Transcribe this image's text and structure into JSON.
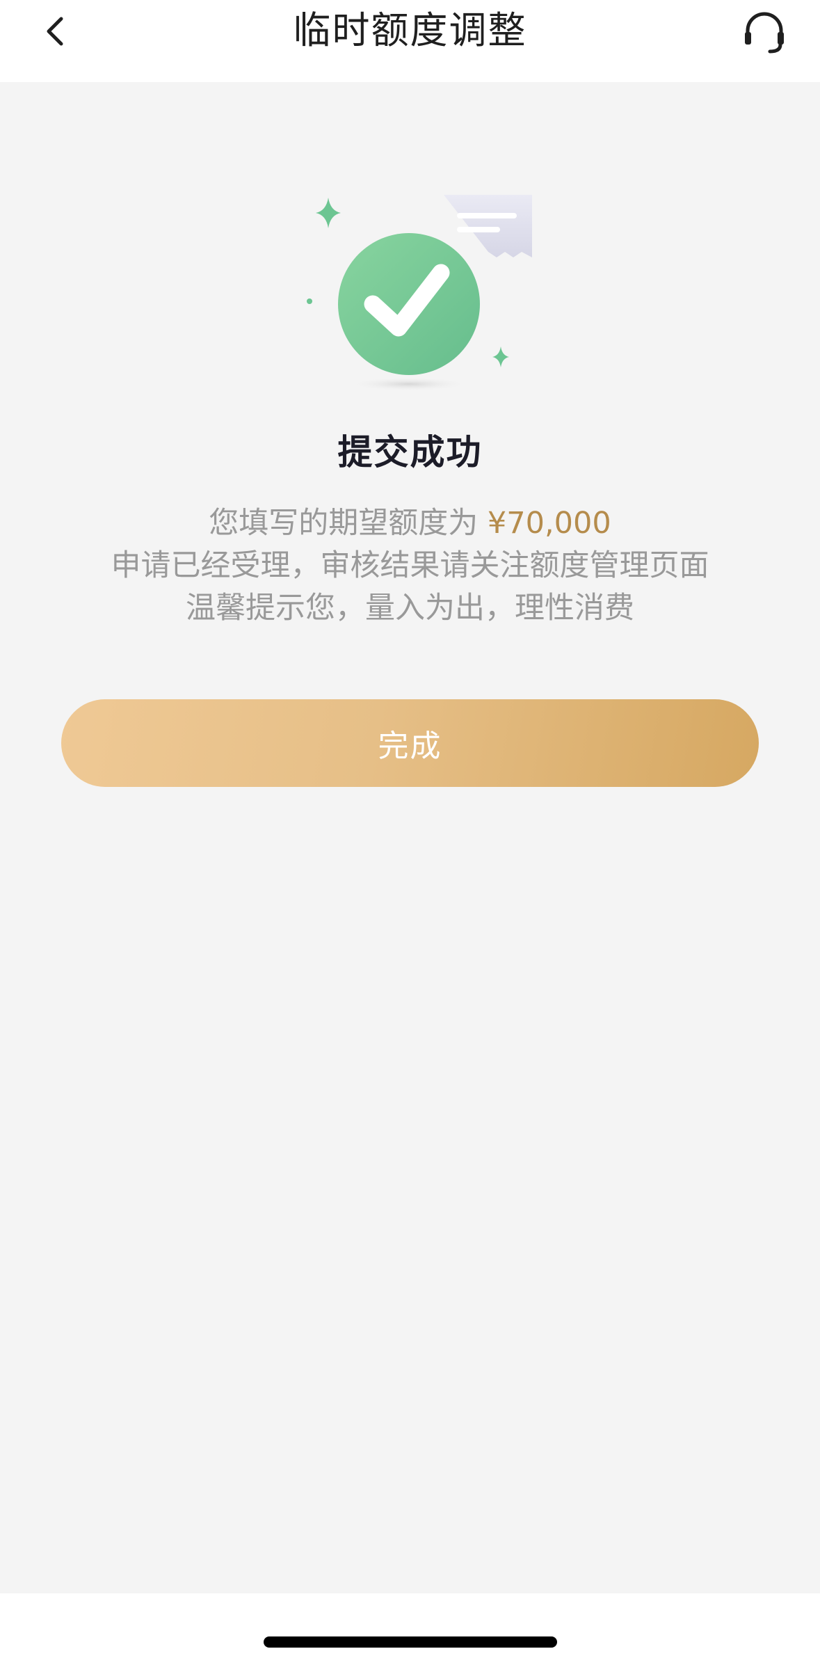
{
  "header": {
    "title": "临时额度调整",
    "back_icon": "chevron-left-icon",
    "support_icon": "headset-icon"
  },
  "result": {
    "icon": "success-check-icon",
    "title": "提交成功",
    "line1_prefix": "您填写的期望额度为 ",
    "amount": "¥70,000",
    "line2": "申请已经受理，审核结果请关注额度管理页面",
    "line3": "温馨提示您，量入为出，理性消费"
  },
  "actions": {
    "done_label": "完成"
  },
  "colors": {
    "accent_gold": "#b58c4c",
    "success_green": "#74c795",
    "button_gradient_start": "#efc995",
    "button_gradient_end": "#d6a862",
    "background": "#f4f4f4"
  }
}
